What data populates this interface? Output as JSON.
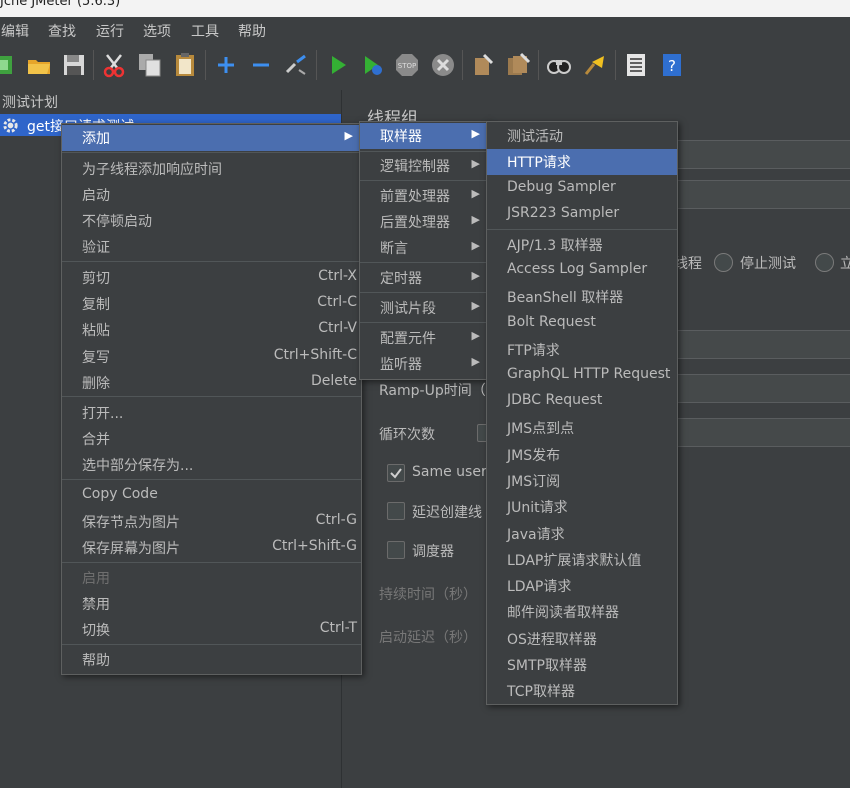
{
  "window": {
    "title": "Jche JMeter (5.6.3)"
  },
  "menubar": [
    "编辑",
    "查找",
    "运行",
    "选项",
    "工具",
    "帮助"
  ],
  "toolbar_icons": [
    "new-icon",
    "open-icon",
    "save-icon",
    "cut-icon",
    "copy-icon",
    "paste-icon",
    "expand-icon",
    "collapse-icon",
    "toggle-icon",
    "start-icon",
    "start-no-pause-icon",
    "stop-icon",
    "shutdown-icon",
    "clear-icon",
    "clear-all-icon",
    "search-icon",
    "reset-search-icon",
    "function-helper-icon",
    "help-icon"
  ],
  "tree": {
    "root": "测试计划",
    "selected": "get接口请求测试"
  },
  "right_panel": {
    "title": "线程组",
    "partial_text_thread": "线程",
    "stop_test": "停止测试",
    "partial_text_now": "立",
    "ramp_up": "Ramp-Up时间（",
    "loop_count": "循环次数",
    "same_user": "Same user o",
    "delay_create": "延迟创建线",
    "scheduler": "调度器",
    "duration": "持续时间（秒）",
    "startup_delay": "启动延迟（秒）"
  },
  "context_menu": {
    "items": [
      {
        "label": "添加",
        "submenu": true
      },
      {
        "label": "为子线程添加响应时间"
      },
      {
        "label": "启动"
      },
      {
        "label": "不停顿启动"
      },
      {
        "label": "验证"
      },
      {
        "label": "剪切",
        "shortcut": "Ctrl-X"
      },
      {
        "label": "复制",
        "shortcut": "Ctrl-C"
      },
      {
        "label": "粘贴",
        "shortcut": "Ctrl-V"
      },
      {
        "label": "复写",
        "shortcut": "Ctrl+Shift-C"
      },
      {
        "label": "删除",
        "shortcut": "Delete"
      },
      {
        "label": "打开..."
      },
      {
        "label": "合并"
      },
      {
        "label": "选中部分保存为..."
      },
      {
        "label": "Copy Code"
      },
      {
        "label": "保存节点为图片",
        "shortcut": "Ctrl-G"
      },
      {
        "label": "保存屏幕为图片",
        "shortcut": "Ctrl+Shift-G"
      },
      {
        "label": "启用",
        "disabled": true
      },
      {
        "label": "禁用"
      },
      {
        "label": "切换",
        "shortcut": "Ctrl-T"
      },
      {
        "label": "帮助"
      }
    ]
  },
  "add_submenu": {
    "items": [
      {
        "label": "取样器",
        "submenu": true
      },
      {
        "label": "逻辑控制器",
        "submenu": true
      },
      {
        "label": "前置处理器",
        "submenu": true
      },
      {
        "label": "后置处理器",
        "submenu": true
      },
      {
        "label": "断言",
        "submenu": true
      },
      {
        "label": "定时器",
        "submenu": true
      },
      {
        "label": "测试片段",
        "submenu": true
      },
      {
        "label": "配置元件",
        "submenu": true
      },
      {
        "label": "监听器",
        "submenu": true
      }
    ]
  },
  "sampler_submenu": {
    "items": [
      "测试活动",
      "HTTP请求",
      "Debug Sampler",
      "JSR223 Sampler",
      "AJP/1.3 取样器",
      "Access Log Sampler",
      "BeanShell 取样器",
      "Bolt Request",
      "FTP请求",
      "GraphQL HTTP Request",
      "JDBC Request",
      "JMS点到点",
      "JMS发布",
      "JMS订阅",
      "JUnit请求",
      "Java请求",
      "LDAP扩展请求默认值",
      "LDAP请求",
      "邮件阅读者取样器",
      "OS进程取样器",
      "SMTP取样器",
      "TCP取样器"
    ],
    "highlighted": "HTTP请求"
  },
  "arrow_glyph": "▶"
}
